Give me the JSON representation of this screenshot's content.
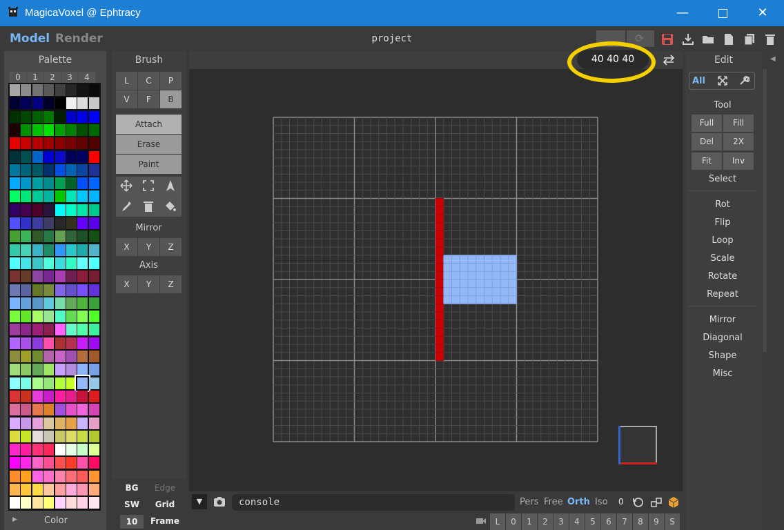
{
  "window": {
    "title": "MagicaVoxel @ Ephtracy",
    "controls": [
      "minimize-icon",
      "maximize-icon",
      "close-icon"
    ]
  },
  "menubar": {
    "tabs": [
      "Model",
      "Render"
    ],
    "active_tab": "Model",
    "project": "project"
  },
  "palette": {
    "title": "Palette",
    "tabs": [
      "0",
      "1",
      "2",
      "3",
      "4"
    ],
    "footer_label": "Color",
    "rows": [
      [
        "#a6a6a6",
        "#8c8c8c",
        "#737373",
        "#595959",
        "#404040",
        "#262626",
        "#141414",
        "#0a0a0a"
      ],
      [
        "#000033",
        "#00005a",
        "#000080",
        "#00002a",
        "#000000",
        "#f0f0f0",
        "#dcdcdc",
        "#c8c8c8"
      ],
      [
        "#003000",
        "#004800",
        "#006000",
        "#007800",
        "#002000",
        "#0000c8",
        "#0000e6",
        "#0000ff"
      ],
      [
        "#1e0000",
        "#009000",
        "#00c000",
        "#00e000",
        "#00a000",
        "#008000",
        "#005000",
        "#006800"
      ],
      [
        "#e60000",
        "#c80000",
        "#b40000",
        "#a00000",
        "#8c0000",
        "#780000",
        "#640000",
        "#500000"
      ],
      [
        "#00323c",
        "#005050",
        "#0064c8",
        "#0000d2",
        "#0a0ac8",
        "#00005a",
        "#000064",
        "#ff0000"
      ],
      [
        "#0078a0",
        "#006478",
        "#005a64",
        "#00326e",
        "#0050e6",
        "#0064b4",
        "#0a46a0",
        "#1e3296"
      ],
      [
        "#00aaff",
        "#0096c8",
        "#00a0a0",
        "#008c8c",
        "#00a050",
        "#006428",
        "#0050ff",
        "#0064ff"
      ],
      [
        "#00ff64",
        "#00e678",
        "#00c896",
        "#00b4a0",
        "#00c800",
        "#00e6b4",
        "#00c8ff",
        "#00b4ff"
      ],
      [
        "#320064",
        "#460050",
        "#500028",
        "#28143c",
        "#00ffff",
        "#00ffc8",
        "#00e6aa",
        "#00c88c"
      ],
      [
        "#5050ff",
        "#3232c8",
        "#3c3ca0",
        "#3c3c64",
        "#282828",
        "#32321e",
        "#6400ff",
        "#5a00e6"
      ],
      [
        "#46a032",
        "#3cb45a",
        "#325a28",
        "#287846",
        "#64a050",
        "#32643c",
        "#1e5028",
        "#145014"
      ],
      [
        "#32c8aa",
        "#46d2b4",
        "#3cb4c8",
        "#1e8c64",
        "#3296ff",
        "#28c8c8",
        "#1eaaaa",
        "#50b4c8"
      ],
      [
        "#50ffff",
        "#46e6e6",
        "#3cc8c8",
        "#50ffdc",
        "#3cdcdc",
        "#32ffc8",
        "#64ffff",
        "#50ffff"
      ],
      [
        "#783232",
        "#643c28",
        "#8c46a0",
        "#782896",
        "#aa3cb4",
        "#6e1e50",
        "#8c1e3c",
        "#781e32"
      ],
      [
        "#6e78b4",
        "#5a64a0",
        "#647828",
        "#788c3c",
        "#8264e6",
        "#6450c8",
        "#7850ff",
        "#6432dc"
      ],
      [
        "#78b4ff",
        "#64a0dc",
        "#5a96c8",
        "#64c8dc",
        "#78dcaa",
        "#64aa5a",
        "#50b43c",
        "#3ca03c"
      ],
      [
        "#78ff3c",
        "#64e628",
        "#aaff64",
        "#96e696",
        "#50ffc8",
        "#64dc50",
        "#82ff50",
        "#50ff28"
      ],
      [
        "#a03ca0",
        "#8c288c",
        "#a01e78",
        "#8c1e50",
        "#ff64ff",
        "#64ffc8",
        "#50ffaa",
        "#3cf0a0"
      ],
      [
        "#b464ff",
        "#aa50e6",
        "#8c3cdc",
        "#ff50aa",
        "#aa3232",
        "#b43250",
        "#c81eff",
        "#a00af0"
      ],
      [
        "#8c8c3c",
        "#a0a028",
        "#6e8c32",
        "#b464aa",
        "#c864c8",
        "#a050b4",
        "#b46e3c",
        "#a05a28"
      ],
      [
        "#a0dc78",
        "#8cc864",
        "#64aa5a",
        "#a0e664",
        "#c8a0ff",
        "#b48cdc",
        "#8cb4ff",
        "#78a0e6"
      ],
      [
        "#8cffff",
        "#78ffe6",
        "#aaff8c",
        "#96e678",
        "#b4ff3c",
        "#c8ff28",
        "#94b8f7",
        "#96c8e6"
      ],
      [
        "#dc3232",
        "#c8321e",
        "#e63cdc",
        "#c81ec8",
        "#ff1ea0",
        "#e61e8c",
        "#c8143c",
        "#dc1e1e"
      ],
      [
        "#dc6ea0",
        "#c85a8c",
        "#e67850",
        "#dc8228",
        "#a050dc",
        "#e650c8",
        "#f064dc",
        "#d246b4"
      ],
      [
        "#dcaaff",
        "#c896e6",
        "#e6a0dc",
        "#dcc8a0",
        "#dcb464",
        "#e6a046",
        "#c8b4ff",
        "#e6a0c8"
      ],
      [
        "#dcdc3c",
        "#c8e628",
        "#e6dcdc",
        "#c8c8b4",
        "#c8c864",
        "#dcdc64",
        "#c8dc46",
        "#b4c832"
      ],
      [
        "#ff28c8",
        "#ff1ea0",
        "#ff3278",
        "#ff285a",
        "#ffffff",
        "#e6ffe6",
        "#c8ffc8",
        "#dcff96"
      ],
      [
        "#ff00ff",
        "#ff28e6",
        "#ff64c8",
        "#ff5096",
        "#ff5050",
        "#ff3c28",
        "#ff50aa",
        "#ff0a64"
      ],
      [
        "#ff8c28",
        "#ffa01e",
        "#ff64e6",
        "#ff6ec8",
        "#ff82aa",
        "#ff6e78",
        "#ff5a5a",
        "#ff9632"
      ],
      [
        "#ffb450",
        "#ffc83c",
        "#ffdc46",
        "#ffc8a0",
        "#ffa0a0",
        "#ffaadc",
        "#ff96b4",
        "#ffaa78"
      ],
      [
        "#ffffff",
        "#ffffc8",
        "#ffe6a0",
        "#ffff78",
        "#ffd2ff",
        "#ffdcdc",
        "#ffd2e6",
        "#ffe6f0"
      ]
    ],
    "selected": {
      "row": 22,
      "col": 6
    }
  },
  "brush": {
    "title": "Brush",
    "modes_row1": [
      "L",
      "C",
      "P"
    ],
    "modes_row2": [
      "V",
      "F",
      "B"
    ],
    "active_mode": "B",
    "actions": [
      "Attach",
      "Erase",
      "Paint"
    ],
    "active_action": "Attach",
    "tools_icons": [
      "move-icon",
      "select-box-icon",
      "pointer-icon",
      "eyedropper-icon",
      "trash-icon",
      "fill-bucket-icon"
    ],
    "mirror_title": "Mirror",
    "mirror": [
      "X",
      "Y",
      "Z"
    ],
    "axis_title": "Axis",
    "axis": [
      "X",
      "Y",
      "Z"
    ],
    "bottom": {
      "bg": "BG",
      "edge": "Edge",
      "sw": "SW",
      "grid": "Grid",
      "frame_value": "10",
      "frame": "Frame"
    }
  },
  "viewport": {
    "dims": "40 40 40",
    "swap_icon": "swap-arrows-icon",
    "voxel_colors": {
      "red": "#cc0000",
      "blue": "#94b8f7"
    }
  },
  "edit": {
    "title": "Edit",
    "filters": [
      "All",
      "expand-icon",
      "wrench-icon"
    ],
    "tool_title": "Tool",
    "tool_buttons": [
      "Full",
      "Fill",
      "Del",
      "2X",
      "Fit",
      "Inv"
    ],
    "select": "Select",
    "group1": [
      "Rot",
      "Flip",
      "Loop",
      "Scale",
      "Rotate",
      "Repeat"
    ],
    "group2": [
      "Mirror",
      "Diagonal",
      "Shape",
      "Misc"
    ]
  },
  "bottom": {
    "console_placeholder": "console",
    "view_modes": [
      "Pers",
      "Free",
      "Orth",
      "Iso"
    ],
    "active_view": "Orth",
    "zero": "0",
    "frames": [
      "L",
      "0",
      "1",
      "2",
      "3",
      "4",
      "5",
      "6",
      "7",
      "8",
      "9",
      "S"
    ]
  },
  "colors": {
    "accent": "#7ab8f5",
    "titlebar": "#1d7fd4",
    "highlight": "#f5d000"
  }
}
